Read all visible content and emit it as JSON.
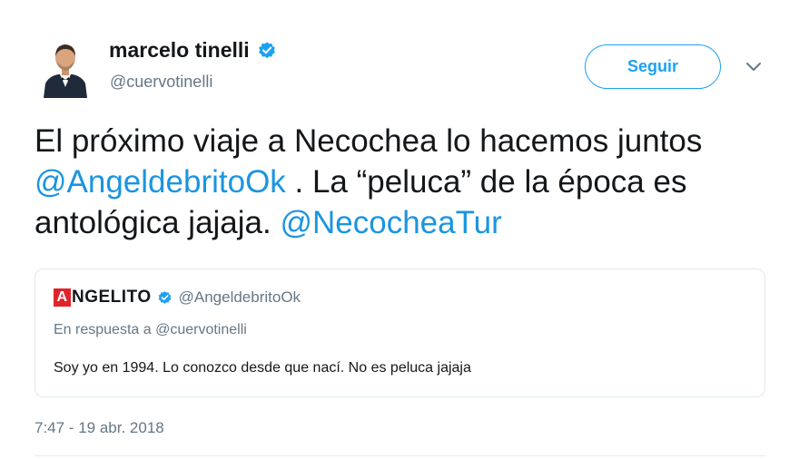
{
  "tweet": {
    "author": {
      "display_name": "marcelo tinelli",
      "handle": "@cuervotinelli",
      "verified": true,
      "avatar_icon": "user-avatar-photo"
    },
    "follow_label": "Seguir",
    "menu_icon": "chevron-down-icon",
    "text_parts": {
      "p1": "El próximo viaje a Necochea lo hacemos juntos ",
      "m1": "@AngeldebritoOk",
      "p2": " . La “peluca” de la época es antológica jajaja. ",
      "m2": "@NecocheaTur"
    },
    "quoted": {
      "logo_letter": "A",
      "logo_rest": "NGELITO",
      "verified": true,
      "handle": "@AngeldebritoOk",
      "reply_to": "En respuesta a @cuervotinelli",
      "text": "Soy yo en 1994. Lo conozco desde que nací. No es peluca jajaja"
    },
    "timestamp": "7:47 - 19 abr. 2018"
  },
  "colors": {
    "accent": "#1da1f2",
    "mention": "#1b95e0",
    "secondary_text": "#657786",
    "logo_red": "#e0242b"
  }
}
